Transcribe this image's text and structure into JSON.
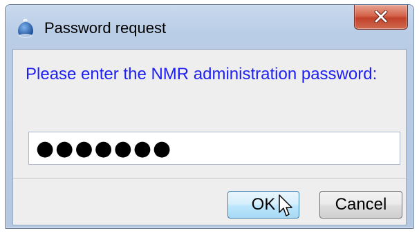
{
  "window": {
    "title": "Password request",
    "icon": "java-duke-icon"
  },
  "dialog": {
    "message": "Please enter the NMR administration password:",
    "password_value": "●●●●●●●",
    "ok_label": "OK",
    "cancel_label": "Cancel"
  },
  "colors": {
    "message_text": "#1f1ff3",
    "titlebar": "#b9cde6",
    "close_button": "#c2422b",
    "ok_button_focus": "#bde6fd"
  }
}
